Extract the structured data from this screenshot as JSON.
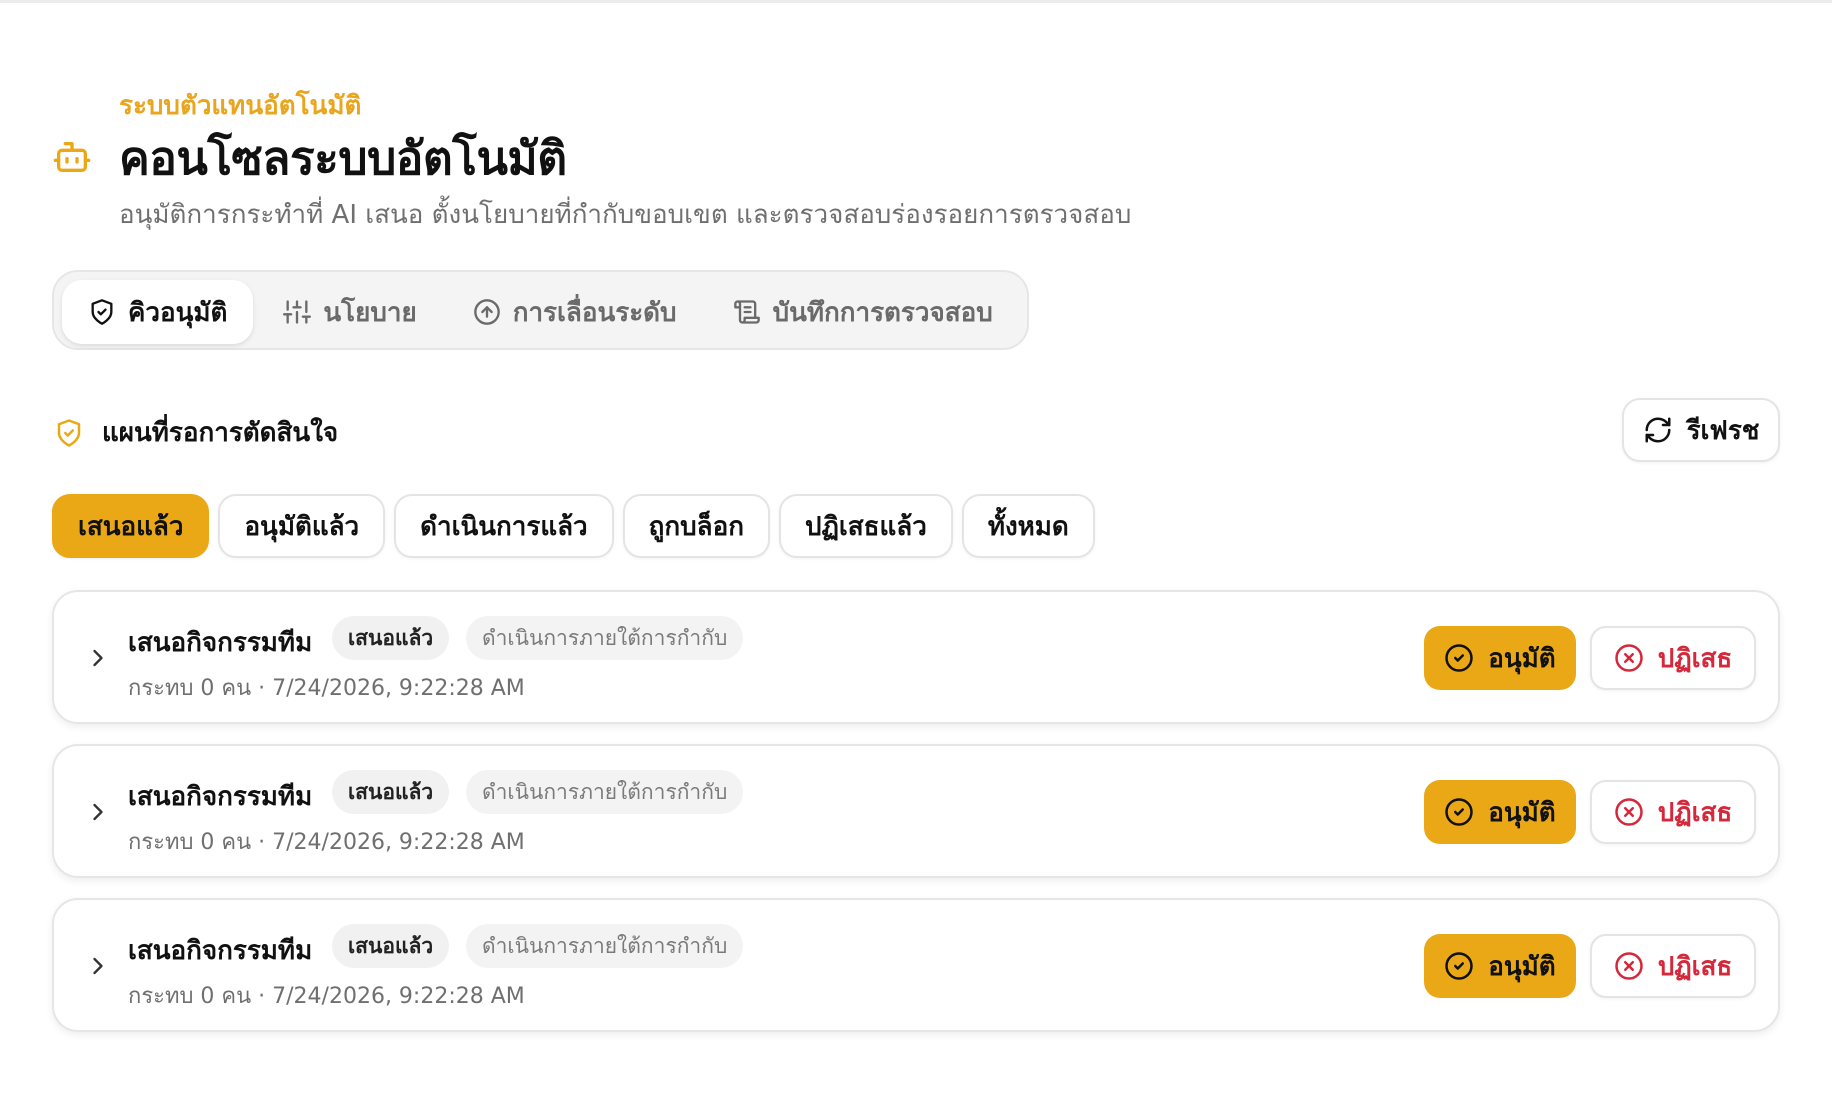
{
  "header": {
    "eyebrow": "ระบบตัวแทนอัตโนมัติ",
    "title": "คอนโซลระบบอัตโนมัติ",
    "subtitle": "อนุมัติการกระทำที่ AI เสนอ ตั้งนโยบายที่กำกับขอบเขต และตรวจสอบร่องรอยการตรวจสอบ",
    "icon": "robot-icon",
    "accent_color": "#eaa817"
  },
  "tabs": [
    {
      "label": "คิวอนุมัติ",
      "icon": "shield-icon",
      "active": true
    },
    {
      "label": "นโยบาย",
      "icon": "sliders-icon",
      "active": false
    },
    {
      "label": "การเลื่อนระดับ",
      "icon": "arrow-up-circle-icon",
      "active": false
    },
    {
      "label": "บันทึกการตรวจสอบ",
      "icon": "scroll-icon",
      "active": false
    }
  ],
  "section": {
    "title": "แผนที่รอการตัดสินใจ",
    "icon": "shield-check-icon",
    "refresh_label": "รีเฟรช",
    "refresh_icon": "refresh-icon"
  },
  "filters": [
    {
      "label": "เสนอแล้ว",
      "active": true
    },
    {
      "label": "อนุมัติแล้ว",
      "active": false
    },
    {
      "label": "ดำเนินการแล้ว",
      "active": false
    },
    {
      "label": "ถูกบล็อก",
      "active": false
    },
    {
      "label": "ปฏิเสธแล้ว",
      "active": false
    },
    {
      "label": "ทั้งหมด",
      "active": false
    }
  ],
  "plans": [
    {
      "title": "เสนอกิจกรรมทีม",
      "status": "เสนอแล้ว",
      "mode": "ดำเนินการภายใต้การกำกับ",
      "meta": "กระทบ 0 คน · 7/24/2026, 9:22:28 AM",
      "approve_label": "อนุมัติ",
      "reject_label": "ปฏิเสธ"
    },
    {
      "title": "เสนอกิจกรรมทีม",
      "status": "เสนอแล้ว",
      "mode": "ดำเนินการภายใต้การกำกับ",
      "meta": "กระทบ 0 คน · 7/24/2026, 9:22:28 AM",
      "approve_label": "อนุมัติ",
      "reject_label": "ปฏิเสธ"
    },
    {
      "title": "เสนอกิจกรรมทีม",
      "status": "เสนอแล้ว",
      "mode": "ดำเนินการภายใต้การกำกับ",
      "meta": "กระทบ 0 คน · 7/24/2026, 9:22:28 AM",
      "approve_label": "อนุมัติ",
      "reject_label": "ปฏิเสธ"
    }
  ],
  "colors": {
    "accent": "#eaa817",
    "danger": "#d6283b",
    "muted": "#6f6f6f"
  }
}
